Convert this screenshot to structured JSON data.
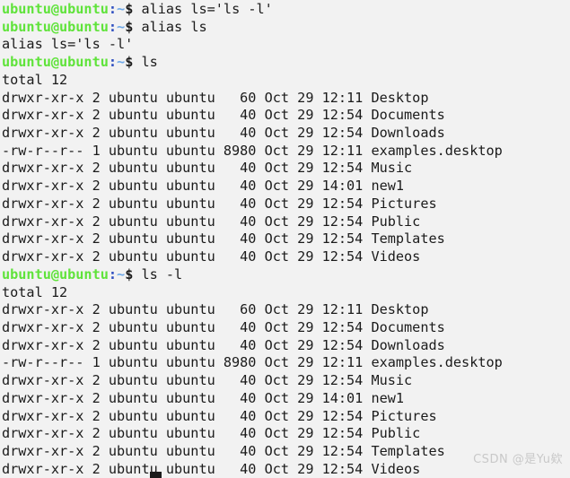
{
  "terminal": {
    "background_color": "#f2f2f2",
    "foreground_color": "#1b1b1b",
    "prompt_color": "#5fe33a",
    "punct_color": "#2f4fc0",
    "tilde_color": "#6ea8e8",
    "user_host": "ubuntu@ubuntu",
    "colon": ":",
    "tilde": "~",
    "dollar": "$ "
  },
  "watermark": {
    "text": "CSDN @是Yu欸",
    "color": "#c9c9c9"
  },
  "cursor": {
    "visible": true,
    "color": "#1b1b1b"
  },
  "lines": [
    {
      "type": "prompt",
      "command": "alias ls='ls -l'"
    },
    {
      "type": "prompt",
      "command": "alias ls"
    },
    {
      "type": "output",
      "text": "alias ls='ls -l'"
    },
    {
      "type": "prompt",
      "command": "ls"
    },
    {
      "type": "output",
      "text": "total 12"
    },
    {
      "type": "output",
      "text": "drwxr-xr-x 2 ubuntu ubuntu   60 Oct 29 12:11 Desktop"
    },
    {
      "type": "output",
      "text": "drwxr-xr-x 2 ubuntu ubuntu   40 Oct 29 12:54 Documents"
    },
    {
      "type": "output",
      "text": "drwxr-xr-x 2 ubuntu ubuntu   40 Oct 29 12:54 Downloads"
    },
    {
      "type": "output",
      "text": "-rw-r--r-- 1 ubuntu ubuntu 8980 Oct 29 12:11 examples.desktop"
    },
    {
      "type": "output",
      "text": "drwxr-xr-x 2 ubuntu ubuntu   40 Oct 29 12:54 Music"
    },
    {
      "type": "output",
      "text": "drwxr-xr-x 2 ubuntu ubuntu   40 Oct 29 14:01 new1"
    },
    {
      "type": "output",
      "text": "drwxr-xr-x 2 ubuntu ubuntu   40 Oct 29 12:54 Pictures"
    },
    {
      "type": "output",
      "text": "drwxr-xr-x 2 ubuntu ubuntu   40 Oct 29 12:54 Public"
    },
    {
      "type": "output",
      "text": "drwxr-xr-x 2 ubuntu ubuntu   40 Oct 29 12:54 Templates"
    },
    {
      "type": "output",
      "text": "drwxr-xr-x 2 ubuntu ubuntu   40 Oct 29 12:54 Videos"
    },
    {
      "type": "prompt",
      "command": "ls -l"
    },
    {
      "type": "output",
      "text": "total 12"
    },
    {
      "type": "output",
      "text": "drwxr-xr-x 2 ubuntu ubuntu   60 Oct 29 12:11 Desktop"
    },
    {
      "type": "output",
      "text": "drwxr-xr-x 2 ubuntu ubuntu   40 Oct 29 12:54 Documents"
    },
    {
      "type": "output",
      "text": "drwxr-xr-x 2 ubuntu ubuntu   40 Oct 29 12:54 Downloads"
    },
    {
      "type": "output",
      "text": "-rw-r--r-- 1 ubuntu ubuntu 8980 Oct 29 12:11 examples.desktop"
    },
    {
      "type": "output",
      "text": "drwxr-xr-x 2 ubuntu ubuntu   40 Oct 29 12:54 Music"
    },
    {
      "type": "output",
      "text": "drwxr-xr-x 2 ubuntu ubuntu   40 Oct 29 14:01 new1"
    },
    {
      "type": "output",
      "text": "drwxr-xr-x 2 ubuntu ubuntu   40 Oct 29 12:54 Pictures"
    },
    {
      "type": "output",
      "text": "drwxr-xr-x 2 ubuntu ubuntu   40 Oct 29 12:54 Public"
    },
    {
      "type": "output",
      "text": "drwxr-xr-x 2 ubuntu ubuntu   40 Oct 29 12:54 Templates"
    },
    {
      "type": "output",
      "text": "drwxr-xr-x 2 ubuntu ubuntu   40 Oct 29 12:54 Videos"
    }
  ]
}
